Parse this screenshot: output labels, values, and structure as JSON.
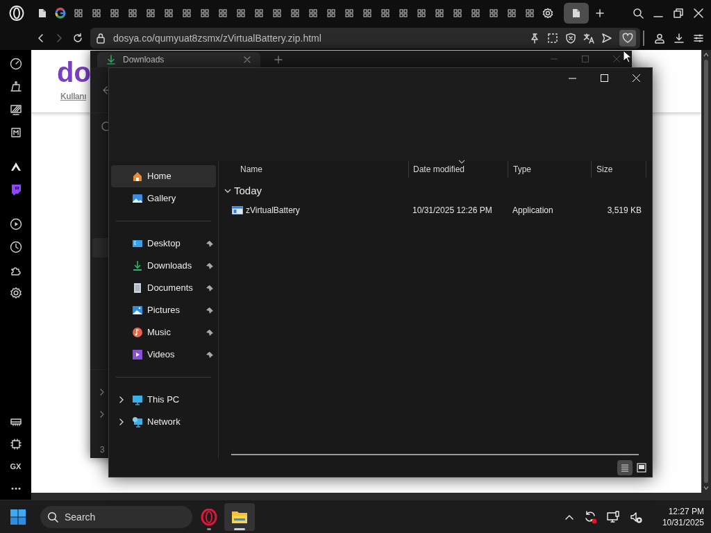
{
  "browser": {
    "tabs": [
      {
        "kind": "page",
        "selected": false
      },
      {
        "kind": "google",
        "selected": false
      },
      {
        "kind": "grid",
        "selected": false
      },
      {
        "kind": "grid",
        "selected": false
      },
      {
        "kind": "grid",
        "selected": false
      },
      {
        "kind": "grid",
        "selected": false
      },
      {
        "kind": "grid",
        "selected": false
      },
      {
        "kind": "grid",
        "selected": false
      },
      {
        "kind": "grid",
        "selected": false
      },
      {
        "kind": "grid",
        "selected": false
      },
      {
        "kind": "grid",
        "selected": false
      },
      {
        "kind": "grid",
        "selected": false
      },
      {
        "kind": "grid",
        "selected": false
      },
      {
        "kind": "grid",
        "selected": false
      },
      {
        "kind": "grid",
        "selected": false
      },
      {
        "kind": "grid",
        "selected": false
      },
      {
        "kind": "grid",
        "selected": false
      },
      {
        "kind": "grid",
        "selected": false
      },
      {
        "kind": "grid",
        "selected": false
      },
      {
        "kind": "grid",
        "selected": false
      },
      {
        "kind": "grid",
        "selected": false
      },
      {
        "kind": "grid",
        "selected": false
      },
      {
        "kind": "grid",
        "selected": false
      },
      {
        "kind": "grid",
        "selected": false
      },
      {
        "kind": "grid",
        "selected": false
      },
      {
        "kind": "grid",
        "selected": false
      },
      {
        "kind": "grid",
        "selected": false
      },
      {
        "kind": "grid",
        "selected": false
      },
      {
        "kind": "settings",
        "selected": false
      },
      {
        "kind": "page",
        "selected": true
      }
    ],
    "forward_disabled": true,
    "address": {
      "url": "dosya.co/qumyuat8zsmx/zVirtualBattery.zip.html",
      "bookmarked": true
    },
    "sidebar_label": "GX"
  },
  "page": {
    "logo_text": "do",
    "link": "Kullanı"
  },
  "downloads_window": {
    "tab_title": "Downloads",
    "status": "3"
  },
  "explorer": {
    "navigation_groups": [
      {
        "items": [
          {
            "label": "Home",
            "kind": "home",
            "selected": true,
            "pinned": false,
            "expandable": false
          },
          {
            "label": "Gallery",
            "kind": "gallery",
            "selected": false,
            "pinned": false,
            "expandable": false
          }
        ]
      },
      {
        "items": [
          {
            "label": "Desktop",
            "kind": "desktop",
            "selected": false,
            "pinned": true,
            "expandable": false
          },
          {
            "label": "Downloads",
            "kind": "downloads",
            "selected": false,
            "pinned": true,
            "expandable": false
          },
          {
            "label": "Documents",
            "kind": "documents",
            "selected": false,
            "pinned": true,
            "expandable": false
          },
          {
            "label": "Pictures",
            "kind": "pictures",
            "selected": false,
            "pinned": true,
            "expandable": false
          },
          {
            "label": "Music",
            "kind": "music",
            "selected": false,
            "pinned": true,
            "expandable": false
          },
          {
            "label": "Videos",
            "kind": "videos",
            "selected": false,
            "pinned": true,
            "expandable": false
          }
        ]
      },
      {
        "items": [
          {
            "label": "This PC",
            "kind": "pc",
            "selected": false,
            "pinned": false,
            "expandable": true
          },
          {
            "label": "Network",
            "kind": "network",
            "selected": false,
            "pinned": false,
            "expandable": true
          }
        ]
      }
    ],
    "columns": [
      {
        "label": "Name",
        "sorted": false
      },
      {
        "label": "Date modified",
        "sorted": true
      },
      {
        "label": "Type",
        "sorted": false
      },
      {
        "label": "Size",
        "sorted": false
      }
    ],
    "groups": [
      {
        "label": "Today",
        "expanded": true,
        "rows": [
          {
            "name": "zVirtualBattery",
            "date_modified": "10/31/2025 12:26 PM",
            "type": "Application",
            "size": "3,519 KB"
          }
        ]
      }
    ],
    "views": [
      {
        "kind": "details",
        "selected": true
      },
      {
        "kind": "tiles",
        "selected": false
      }
    ]
  },
  "taskbar": {
    "search": {
      "placeholder": "Search"
    },
    "apps": [
      {
        "kind": "opera",
        "active": false
      },
      {
        "kind": "explorer",
        "active": true
      }
    ],
    "time": "12:27 PM",
    "date": "10/31/2025"
  }
}
